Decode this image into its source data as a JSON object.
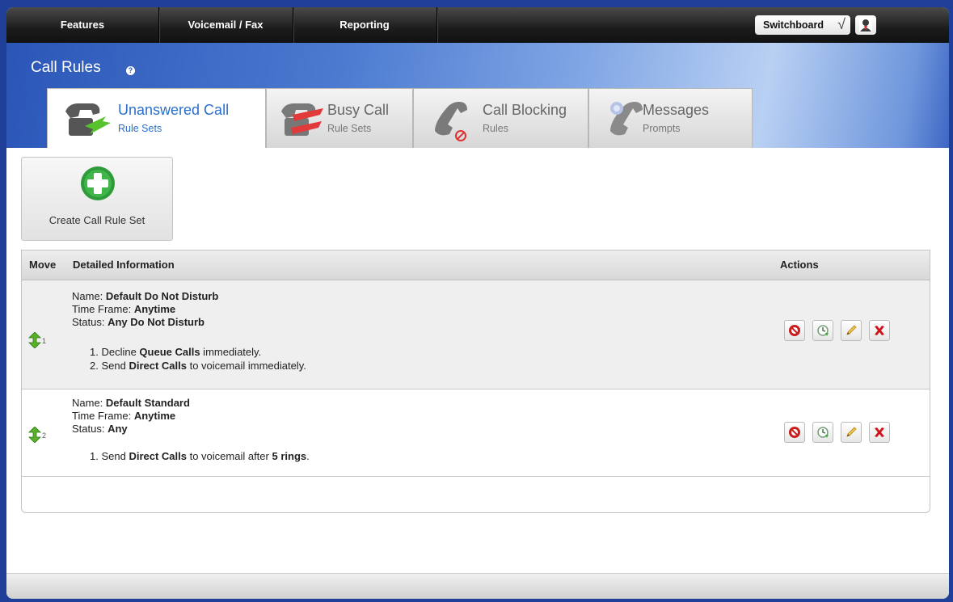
{
  "nav": {
    "items": [
      "Features",
      "Voicemail / Fax",
      "Reporting"
    ],
    "switchboard_label": "Switchboard",
    "switchboard_check": "√"
  },
  "page": {
    "title": "Call Rules",
    "help": "?"
  },
  "tabs": [
    {
      "title": "Unanswered Call",
      "subtitle": "Rule Sets",
      "active": true
    },
    {
      "title": "Busy Call",
      "subtitle": "Rule Sets",
      "active": false
    },
    {
      "title": "Call Blocking",
      "subtitle": "Rules",
      "active": false
    },
    {
      "title": "Messages",
      "subtitle": "Prompts",
      "active": false
    }
  ],
  "create_button": {
    "label": "Create Call Rule Set"
  },
  "table": {
    "headers": {
      "move": "Move",
      "info": "Detailed Information",
      "actions": "Actions"
    },
    "rows": [
      {
        "order": "1",
        "name_label": "Name: ",
        "name": "Default Do Not Disturb",
        "timeframe_label": "Time Frame: ",
        "timeframe": "Anytime",
        "status_label": "Status: ",
        "status": "Any Do Not Disturb",
        "steps": [
          {
            "pre": "1. Decline ",
            "b1": "Queue Calls",
            "mid": " immediately.",
            "b2": "",
            "post": ""
          },
          {
            "pre": "2. Send ",
            "b1": "Direct Calls",
            "mid": " to voicemail immediately.",
            "b2": "",
            "post": ""
          }
        ]
      },
      {
        "order": "2",
        "name_label": "Name: ",
        "name": "Default Standard",
        "timeframe_label": "Time Frame: ",
        "timeframe": "Anytime",
        "status_label": "Status: ",
        "status": "Any",
        "steps": [
          {
            "pre": "1. Send ",
            "b1": "Direct Calls",
            "mid": " to voicemail after ",
            "b2": "5 rings",
            "post": "."
          }
        ]
      }
    ]
  },
  "icons": {
    "disable": "block-icon",
    "schedule": "clock-icon",
    "edit": "pencil-icon",
    "delete": "delete-x-icon"
  },
  "colors": {
    "accent": "#2a6fc9",
    "delete": "#d0141a",
    "disable": "#c81e1e",
    "add": "#2e9a3a"
  }
}
